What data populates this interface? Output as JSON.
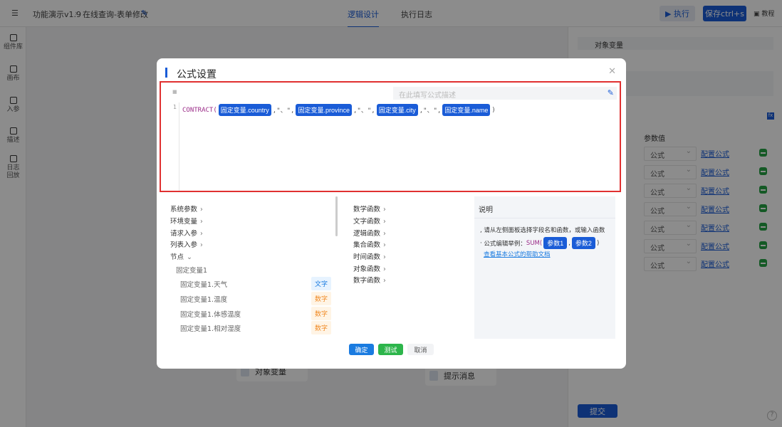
{
  "topbar": {
    "breadcrumb": [
      "功能演示v1.9",
      "在线查询-表单修改"
    ],
    "tabs": [
      "逻辑设计",
      "执行日志"
    ],
    "run": "执行",
    "save": "保存ctrl+s",
    "tutorial": "教程"
  },
  "sidebar": [
    "组件库",
    "画布",
    "入参",
    "描述",
    "日志回放"
  ],
  "canvas": {
    "nodes": [
      "对象变量",
      "提示消息"
    ]
  },
  "right_panel": {
    "name": "对象变量",
    "col_header": "参数值",
    "rows": [
      {
        "type": "公式",
        "link": "配置公式"
      },
      {
        "type": "公式",
        "link": "配置公式"
      },
      {
        "type": "公式",
        "link": "配置公式"
      },
      {
        "type": "公式",
        "link": "配置公式"
      },
      {
        "type": "公式",
        "link": "配置公式"
      },
      {
        "type": "公式",
        "link": "配置公式"
      },
      {
        "type": "公式",
        "link": "配置公式"
      }
    ],
    "submit": "提交"
  },
  "modal": {
    "title": "公式设置",
    "desc_placeholder": "在此填写公式描述",
    "line_number": "1",
    "formula": {
      "fn": "CONTRACT(",
      "sep": ",\"、\",",
      "close": ")",
      "vars": [
        "固定变量.country",
        "固定变量.province",
        "固定变量.city",
        "固定变量.name"
      ]
    },
    "fields": [
      {
        "label": "系统参数"
      },
      {
        "label": "环境变量"
      },
      {
        "label": "请求入参"
      },
      {
        "label": "列表入参"
      },
      {
        "label": "节点"
      }
    ],
    "node_group": "固定变量1",
    "node_fields": [
      {
        "label": "固定变量1.天气",
        "type": "文字"
      },
      {
        "label": "固定变量1.温度",
        "type": "数字"
      },
      {
        "label": "固定变量1.体感温度",
        "type": "数字"
      },
      {
        "label": "固定变量1.相对湿度",
        "type": "数字"
      }
    ],
    "functions": [
      "数学函数",
      "文字函数",
      "逻辑函数",
      "集合函数",
      "时间函数",
      "对象函数",
      "数字函数"
    ],
    "help": {
      "title": "说明",
      "line1": "请从左侧面板选择字段名和函数，或输入函数",
      "line2": "公式编辑举例：",
      "example_fn": "SUM(",
      "p1": "参数1",
      "p2": "参数2",
      "link": "查看基本公式的帮助文档"
    },
    "buttons": {
      "ok": "确定",
      "test": "测试",
      "cancel": "取消"
    }
  }
}
